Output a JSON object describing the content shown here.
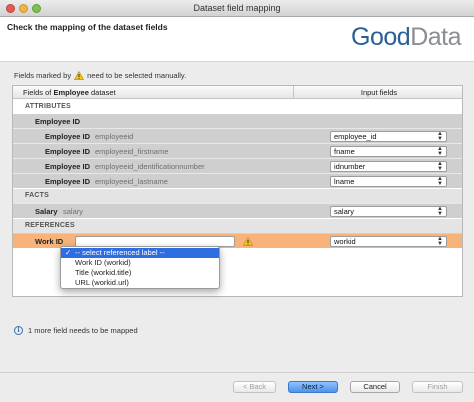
{
  "window": {
    "title": "Dataset field mapping"
  },
  "header": {
    "title": "Check the mapping of the dataset fields",
    "logo_part1": "Good",
    "logo_part2": "Data"
  },
  "notice": {
    "prefix": "Fields marked by",
    "suffix": "need to be selected manually."
  },
  "table": {
    "col_left_prefix": "Fields of",
    "col_left_name": "Employee",
    "col_left_suffix": "dataset",
    "col_right": "Input fields",
    "sections": {
      "attributes": "ATTRIBUTES",
      "facts": "FACTS",
      "references": "REFERENCES"
    },
    "group_employee_id": "Employee ID",
    "attribute_rows": [
      {
        "label": "Employee ID",
        "field": "employeeid",
        "input": "employee_id"
      },
      {
        "label": "Employee ID",
        "field": "employeeid_firstname",
        "input": "fname"
      },
      {
        "label": "Employee ID",
        "field": "employeeid_identificationnumber",
        "input": "idnumber"
      },
      {
        "label": "Employee ID",
        "field": "employeeid_lastname",
        "input": "lname"
      }
    ],
    "fact_row": {
      "label": "Salary",
      "field": "salary",
      "input": "salary"
    },
    "reference_row": {
      "label": "Work ID",
      "input": "workid"
    }
  },
  "label_dropdown": {
    "options": [
      "-- select referenced label --",
      "Work ID (workid)",
      "Title (workid.title)",
      "URL (workid.url)"
    ],
    "selected_index": 0
  },
  "info": {
    "text": "1 more field needs to be mapped"
  },
  "footer": {
    "back": "< Back",
    "next": "Next >",
    "cancel": "Cancel",
    "finish": "Finish"
  },
  "colors": {
    "warning_row": "#f7b37a",
    "selection": "#2f6ee0",
    "logo_blue": "#2a5f96"
  }
}
